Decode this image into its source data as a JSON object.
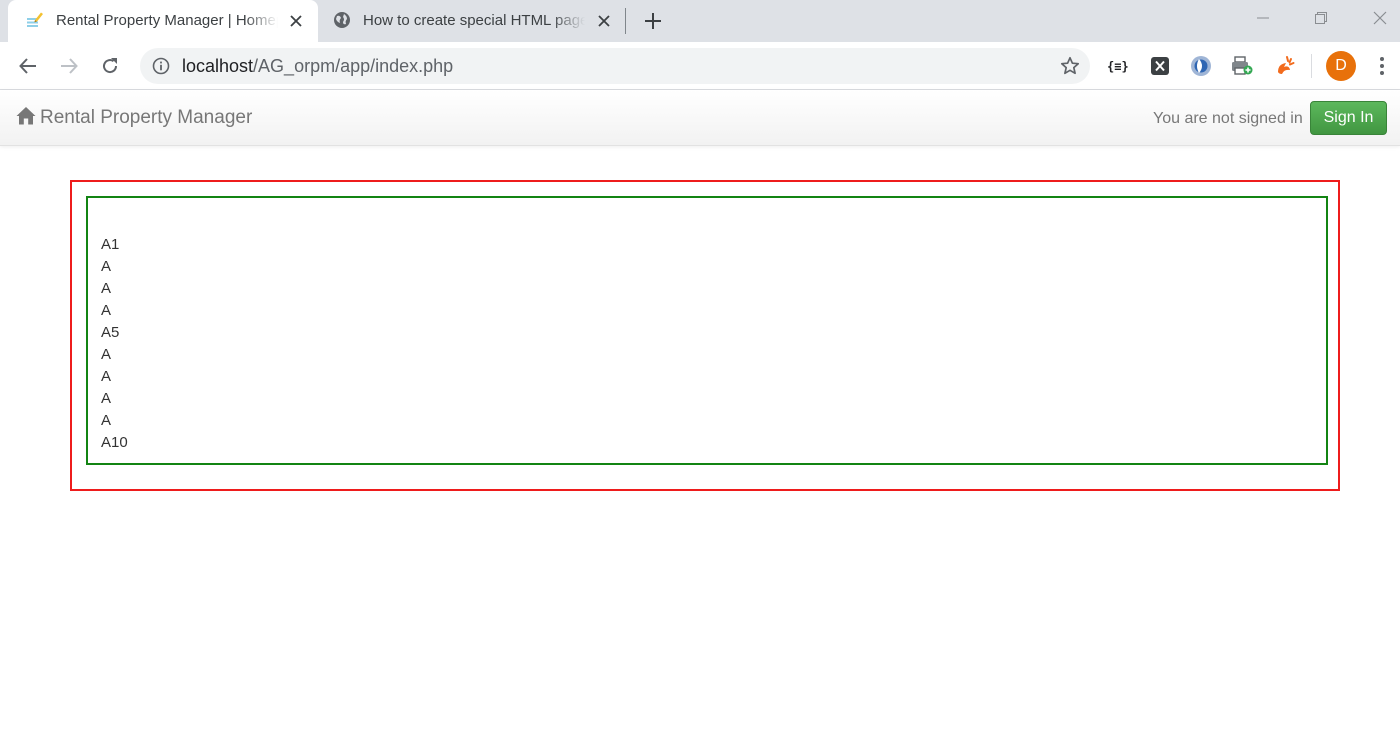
{
  "browser": {
    "tabs": [
      {
        "title": "Rental Property Manager | Homepage",
        "active": true,
        "favicon": "notepad-pencil-icon"
      },
      {
        "title": "How to create special HTML pages",
        "active": false,
        "favicon": "globe-icon"
      }
    ],
    "url": {
      "host": "localhost",
      "path": "/AG_orpm/app/index.php"
    },
    "extensions": [
      "braces-extension-icon",
      "x-extension-icon",
      "crescent-extension-icon",
      "printer-plus-extension-icon",
      "sparkle-extension-icon"
    ],
    "profile_initial": "D",
    "profile_color": "#e8710a"
  },
  "navbar": {
    "brand": "Rental Property Manager",
    "status_text": "You are not signed in",
    "signin_label": "Sign In"
  },
  "content": {
    "items": [
      "A1",
      "A",
      "A",
      "A",
      "A5",
      "A",
      "A",
      "A",
      "A",
      "A10"
    ]
  },
  "colors": {
    "outer_border": "#ee1c1c",
    "inner_border": "#138413",
    "signin_button": "#4cae4c"
  }
}
